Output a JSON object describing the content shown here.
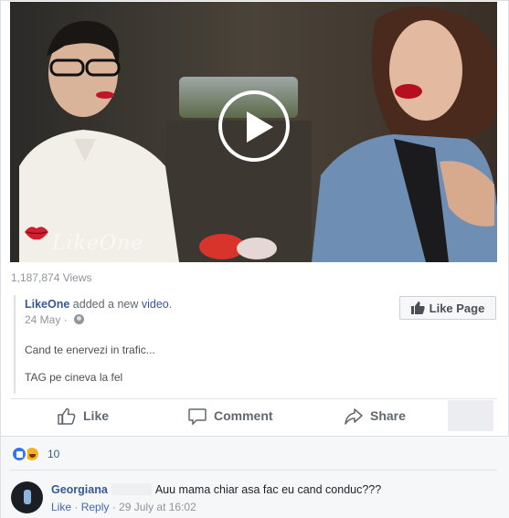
{
  "video": {
    "watermark": "LikeOne",
    "views": "1,187,874 Views"
  },
  "post": {
    "page_name": "LikeOne",
    "action_text": " added a new ",
    "object_text": "video",
    "object_suffix": ".",
    "date": "24 May",
    "separator": " · ",
    "description_line1": "Cand te enervezi in trafic...",
    "description_line2": "TAG pe cineva la fel",
    "like_page_label": "Like Page"
  },
  "actions": {
    "like_label": "Like",
    "comment_label": "Comment",
    "share_label": "Share"
  },
  "reactions": {
    "count": "10",
    "types": [
      "like-icon",
      "haha-icon"
    ]
  },
  "comment": {
    "author": "Georgiana",
    "text": "Auu mama chiar asa fac eu cand conduc???",
    "like_link": "Like",
    "reply_link": "Reply",
    "dot": " · ",
    "timestamp": "29 July at 16:02"
  },
  "colors": {
    "link_blue": "#365899",
    "muted_gray": "#90949c",
    "reaction_like": "#3578e5",
    "reaction_haha": "#f7b125"
  }
}
